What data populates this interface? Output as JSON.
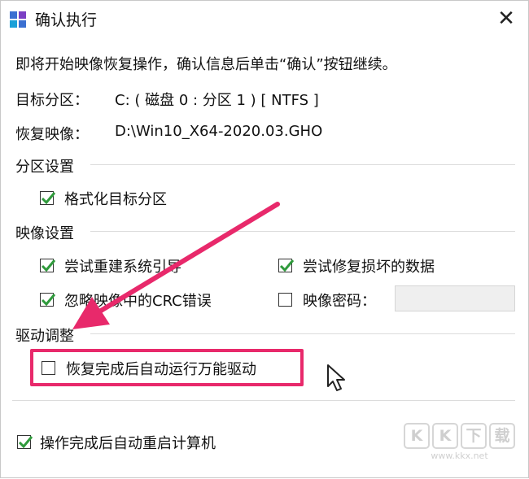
{
  "window": {
    "title": "确认执行",
    "close_label": "✕"
  },
  "intro": "即将开始映像恢复操作，确认信息后单击“确认”按钮继续。",
  "target": {
    "label": "目标分区：",
    "value": "C: ( 磁盘 0 : 分区 1 ) [ NTFS ]"
  },
  "image": {
    "label": "恢复映像：",
    "value": "D:\\Win10_X64-2020.03.GHO"
  },
  "partition_settings": {
    "heading": "分区设置",
    "format": {
      "label": "格式化目标分区",
      "checked": true
    }
  },
  "image_settings": {
    "heading": "映像设置",
    "rebuild_boot": {
      "label": "尝试重建系统引导",
      "checked": true
    },
    "repair_data": {
      "label": "尝试修复损坏的数据",
      "checked": true
    },
    "ignore_crc": {
      "label": "忽略映像中的CRC错误",
      "checked": true
    },
    "password": {
      "label": "映像密码：",
      "checked": false,
      "value": ""
    }
  },
  "driver_settings": {
    "heading": "驱动调整",
    "auto_driver": {
      "label": "恢复完成后自动运行万能驱动",
      "checked": false
    }
  },
  "restart": {
    "label": "操作完成后自动重启计算机",
    "checked": true
  },
  "watermark": {
    "letters": [
      "K",
      "K",
      "下",
      "载"
    ],
    "url": "www.kkx.net"
  },
  "colors": {
    "highlight": "#e8296b",
    "check": "#2f9a3c"
  }
}
